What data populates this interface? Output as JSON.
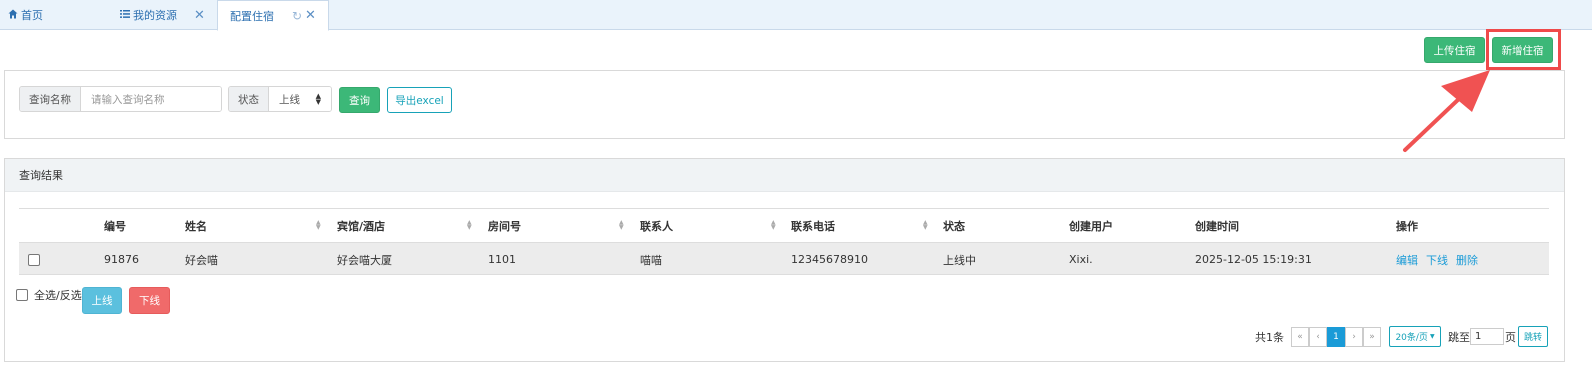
{
  "tabs": [
    {
      "label": "首页",
      "icon": "home-icon"
    },
    {
      "label": "我的资源",
      "icon": "list-icon"
    },
    {
      "label": "配置住宿",
      "icon": "refresh-icon"
    }
  ],
  "tab_close_glyph": "✕",
  "tab_refresh_glyph": "↻",
  "toolbar": {
    "upload_label": "上传住宿",
    "add_label": "新增住宿"
  },
  "search": {
    "name_label": "查询名称",
    "name_placeholder": "请输入查询名称",
    "status_label": "状态",
    "status_value": "上线",
    "query_label": "查询",
    "export_label": "导出excel"
  },
  "results": {
    "title": "查询结果",
    "columns": [
      "编号",
      "姓名",
      "宾馆/酒店",
      "房间号",
      "联系人",
      "联系电话",
      "状态",
      "创建用户",
      "创建时间",
      "操作"
    ],
    "rows": [
      {
        "id": "91876",
        "name": "好会喵",
        "hotel": "好会喵大厦",
        "room": "1101",
        "contact": "喵喵",
        "phone": "12345678910",
        "status": "上线中",
        "creator": "Xixi.",
        "created_at": "2025-12-05 15:19:31",
        "actions": [
          "编辑",
          "下线",
          "删除"
        ]
      }
    ],
    "select_all_label": "全选/反选",
    "online_label": "上线",
    "offline_label": "下线"
  },
  "pagination": {
    "total_text": "共1条",
    "first": "«",
    "prev": "‹",
    "current_page": "1",
    "next": "›",
    "last": "»",
    "page_size": "20条/页",
    "jump_prefix": "跳至",
    "jump_value": "1",
    "jump_suffix": "页",
    "jump_button": "跳转"
  },
  "colors": {
    "accent_green": "#3cb878",
    "highlight_red": "#ef4a4a",
    "link_blue": "#1a9bd7"
  }
}
